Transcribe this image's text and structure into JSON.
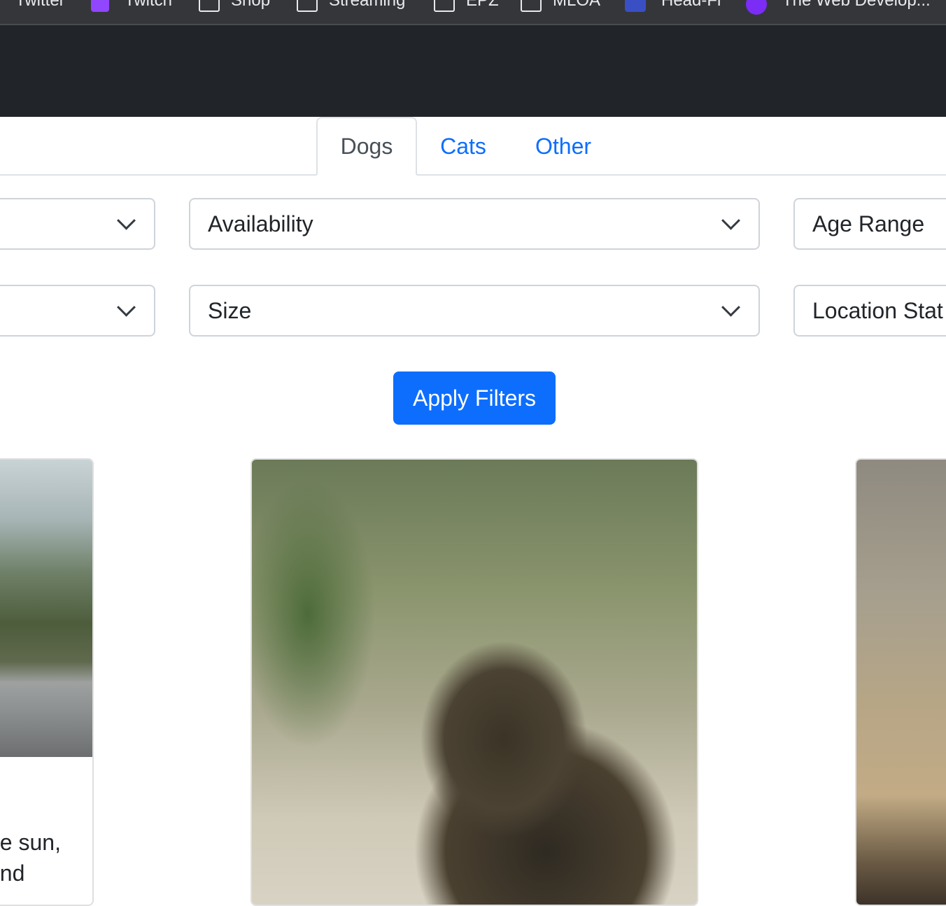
{
  "bookmarks": [
    {
      "label": "Twitter",
      "icon": "bookmark-favicon"
    },
    {
      "label": "Twitch",
      "icon": "twitch-icon"
    },
    {
      "label": "Shop",
      "icon": "folder-icon"
    },
    {
      "label": "Streaming",
      "icon": "folder-icon"
    },
    {
      "label": "EPZ",
      "icon": "folder-icon"
    },
    {
      "label": "MLOA",
      "icon": "folder-icon"
    },
    {
      "label": "Head-Fi",
      "icon": "head-fi-icon"
    },
    {
      "label": "The Web Develop...",
      "icon": "web-dev-icon"
    }
  ],
  "tabs": {
    "dogs": "Dogs",
    "cats": "Cats",
    "other": "Other"
  },
  "filters": {
    "availability": "Availability",
    "age_range": "Age Range",
    "size": "Size",
    "location_state": "Location Stat"
  },
  "apply_label": "Apply Filters",
  "cards": {
    "left_text_line1": "he sun,",
    "left_text_line2": "and"
  },
  "colors": {
    "primary": "#0d6efd",
    "navbar": "#212529",
    "border": "#ced4da"
  }
}
